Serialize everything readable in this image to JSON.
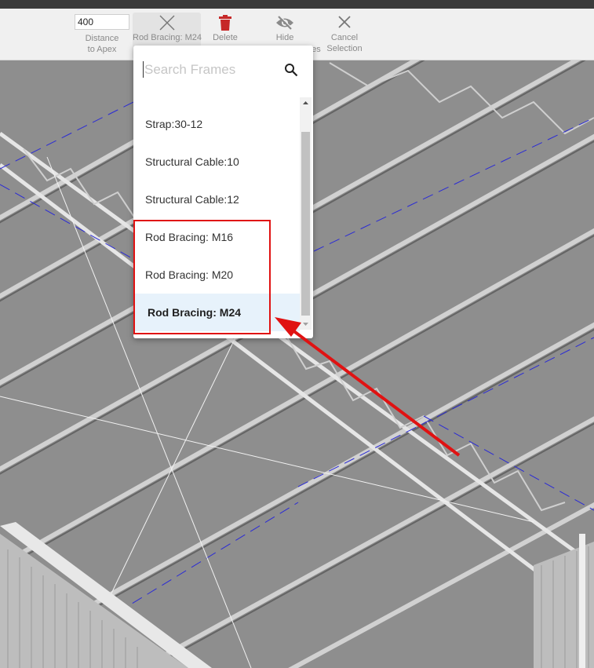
{
  "toolbar": {
    "distance_value": "400",
    "distance_label_line1": "Distance",
    "distance_label_line2": "to Apex",
    "rod_bracing_label": "Rod Bracing: M24",
    "delete_label": "Delete",
    "hide_label": "Hide",
    "hide_label_suffix": "es",
    "cancel_label_line1": "Cancel",
    "cancel_label_line2": "Selection",
    "delete_icon_color": "#c62828",
    "icons": {
      "rod_bracing": "cross-bracing-icon",
      "delete": "trash-icon",
      "hide": "eye-slash-icon",
      "cancel": "close-icon"
    }
  },
  "dropdown": {
    "search_placeholder": "Search Frames",
    "search_icon": "search-icon",
    "items": [
      {
        "label": "Strap:30-12"
      },
      {
        "label": "Structural Cable:10"
      },
      {
        "label": "Structural Cable:12"
      },
      {
        "label": "Rod Bracing: M16"
      },
      {
        "label": "Rod Bracing: M20"
      },
      {
        "label": "Rod Bracing: M24",
        "selected": true
      }
    ],
    "selected_bg": "#e7f2fb"
  },
  "annotation": {
    "color": "#e01212",
    "arrow_icon": "red-arrow-annotation"
  }
}
